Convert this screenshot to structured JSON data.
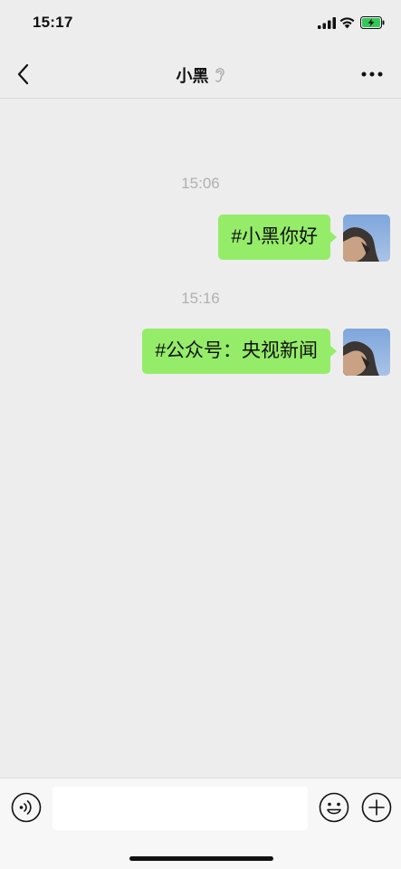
{
  "status_bar": {
    "time": "15:17"
  },
  "nav": {
    "title": "小黑"
  },
  "messages": [
    {
      "timestamp": "15:06",
      "text": "#小黑你好",
      "sender": "self"
    },
    {
      "timestamp": "15:16",
      "text": "#公众号：央视新闻",
      "sender": "self"
    }
  ],
  "input_bar": {
    "placeholder": ""
  },
  "colors": {
    "background": "#ededed",
    "bubble_self": "#95ec69",
    "timestamp": "#b0b0b0",
    "battery_charging": "#34c759"
  },
  "icons": {
    "back": "chevron-left-icon",
    "ear": "ear-icon",
    "more": "more-dots-icon",
    "voice": "voice-icon",
    "emoji": "emoji-icon",
    "plus": "plus-icon"
  }
}
